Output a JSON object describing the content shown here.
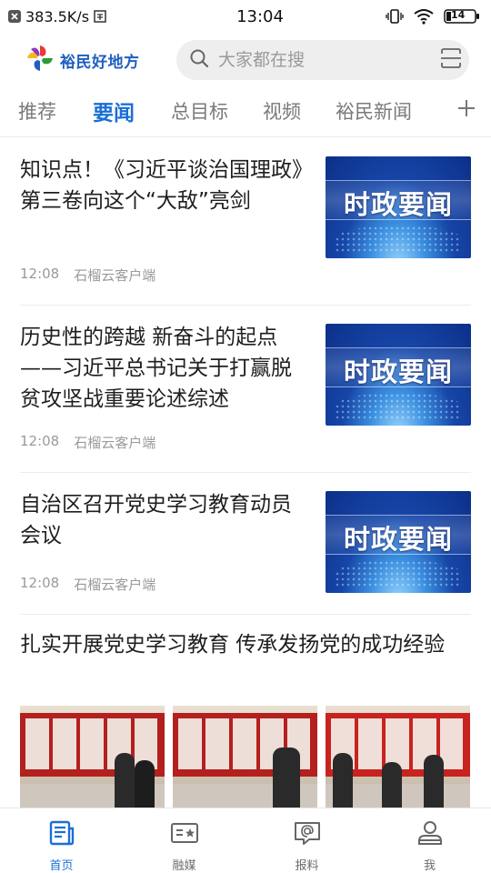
{
  "status_bar": {
    "net_speed": "383.5K/s",
    "time": "13:04",
    "battery": "14"
  },
  "header": {
    "logo_text": "裕民好地方",
    "search_placeholder": "大家都在搜"
  },
  "tabs": [
    "推荐",
    "要闻",
    "总目标",
    "视频",
    "裕民新闻"
  ],
  "active_tab": "要闻",
  "news": [
    {
      "title": "知识点！《习近平谈治国理政》第三卷向这个“大敌”亮剑",
      "time": "12:08",
      "source": "石榴云客户端",
      "thumb_text": "时政要闻"
    },
    {
      "title": "历史性的跨越 新奋斗的起点——习近平总书记关于打赢脱贫攻坚战重要论述综述",
      "time": "12:08",
      "source": "石榴云客户端",
      "thumb_text": "时政要闻"
    },
    {
      "title": "自治区召开党史学习教育动员会议",
      "time": "12:08",
      "source": "石榴云客户端",
      "thumb_text": "时政要闻"
    }
  ],
  "big_news": {
    "title": "扎实开展党史学习教育 传承发扬党的成功经验"
  },
  "bottom_nav": [
    {
      "label": "首页",
      "icon": "home-news-icon"
    },
    {
      "label": "融媒",
      "icon": "media-card-icon"
    },
    {
      "label": "报料",
      "icon": "report-message-icon"
    },
    {
      "label": "我",
      "icon": "user-icon"
    }
  ],
  "colors": {
    "accent": "#1a6fd6",
    "thumb_blue": "#1646a8",
    "exhibit_red": "#b4201d"
  }
}
